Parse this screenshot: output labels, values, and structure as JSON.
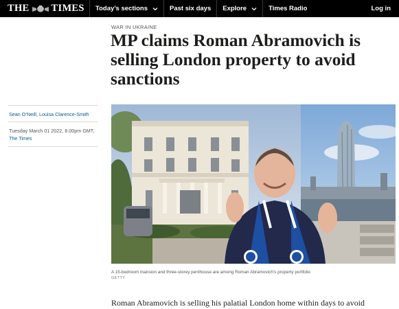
{
  "header": {
    "logo_left": "THE",
    "logo_right": "TIMES",
    "nav": [
      {
        "label": "Today’s sections",
        "has_dropdown": true
      },
      {
        "label": "Past six days",
        "has_dropdown": false
      },
      {
        "label": "Explore",
        "has_dropdown": true
      },
      {
        "label": "Times Radio",
        "has_dropdown": false
      }
    ],
    "login_label": "Log in"
  },
  "article": {
    "section": "WAR IN UKRAINE",
    "headline": "MP claims Roman Abramovich is selling London property to avoid sanctions",
    "authors": "Sean O’Neill, Louisa Clarence-Smith",
    "date": "Tuesday March 01 2022, 8.00pm GMT,",
    "publication": "The Times",
    "image_caption": "A 15-bedroom mansion and three-storey penthouse are among Roman Abramovich’s property portfolio",
    "image_credit": "GETTY",
    "body_first_line": "Roman Abramovich is selling his palatial London home within days to avoid"
  },
  "colors": {
    "topbar_bg": "#000000",
    "link_blue": "#005c8a",
    "text_dark": "#1d1d1b"
  }
}
